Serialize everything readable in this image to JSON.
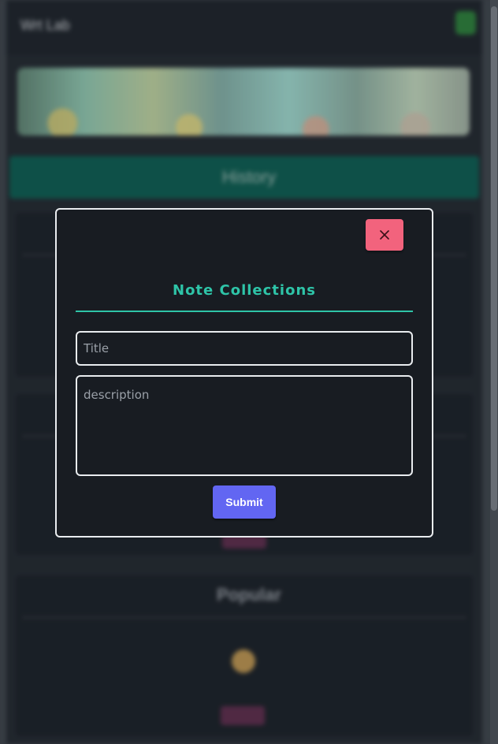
{
  "background": {
    "header_title": "Wrt Lab",
    "history_label": "History",
    "popular_label": "Popular"
  },
  "modal": {
    "close_icon": "close-icon",
    "title": "Note Collections",
    "title_placeholder": "Title",
    "description_placeholder": "description",
    "submit_label": "Submit"
  },
  "colors": {
    "accent": "#2ec4a8",
    "close_button": "#f2637d",
    "submit_button": "#6266f2",
    "modal_background": "#181c22"
  }
}
